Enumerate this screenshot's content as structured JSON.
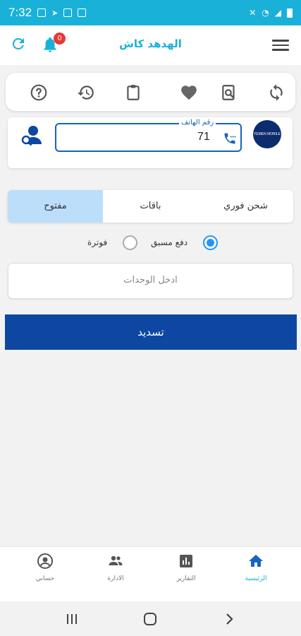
{
  "status_bar": {
    "time": "7:32"
  },
  "app_bar": {
    "title": "الهدهد كاش",
    "notification_count": "0",
    "icons": [
      "refresh-icon",
      "bell-icon",
      "hamburger-menu-icon"
    ]
  },
  "toolbar": {
    "icons": [
      "help-icon",
      "history-icon",
      "clipboard-icon",
      "favorite-heart-icon",
      "search-document-icon",
      "sync-icon"
    ]
  },
  "phone": {
    "label": "رقم الهاتف",
    "value": "71",
    "operator_logo_text": "YEMEN MOBILE"
  },
  "tabs": [
    {
      "label": "مفتوح",
      "active": true
    },
    {
      "label": "باقات",
      "active": false
    },
    {
      "label": "شحن فوري",
      "active": false
    }
  ],
  "payment_type": {
    "options": [
      {
        "label": "دفع مسبق",
        "checked": true
      },
      {
        "label": "فوترة",
        "checked": false
      }
    ]
  },
  "units_input": {
    "placeholder": "ادخل الوحدات",
    "value": ""
  },
  "pay_button": {
    "label": "تسديد"
  },
  "bottom_nav": [
    {
      "label": "حسابي",
      "icon": "account-circle-icon",
      "active": false
    },
    {
      "label": "الادارة",
      "icon": "people-icon",
      "active": false
    },
    {
      "label": "التقارير",
      "icon": "bar-chart-icon",
      "active": false
    },
    {
      "label": "الرئيسية",
      "icon": "home-icon",
      "active": true
    }
  ],
  "colors": {
    "primary": "#1ab1d8",
    "button": "#0d47a1",
    "accent_blue": "#1565c0",
    "tab_active": "#bbdefb",
    "badge": "#e53935"
  }
}
